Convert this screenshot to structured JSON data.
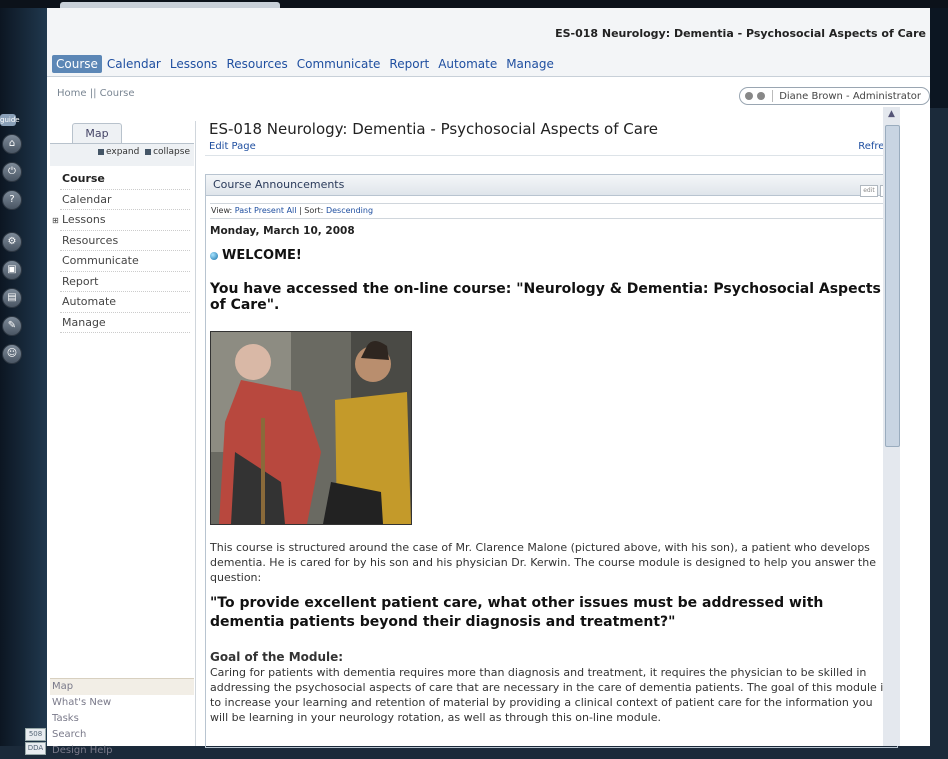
{
  "course_title": "ES-018 Neurology: Dementia - Psychosocial Aspects of Care",
  "nav": {
    "items": [
      "Course",
      "Calendar",
      "Lessons",
      "Resources",
      "Communicate",
      "Report",
      "Automate",
      "Manage"
    ],
    "active": "Course"
  },
  "breadcrumb": "Home || Course",
  "user": "Diane Brown - Administrator",
  "guide_label": "guide",
  "sidebar": {
    "map_tab": "Map",
    "expand": "expand",
    "collapse": "collapse",
    "items": [
      "Course",
      "Calendar",
      "Lessons",
      "Resources",
      "Communicate",
      "Report",
      "Automate",
      "Manage"
    ],
    "footer": [
      "Map",
      "What's New",
      "Tasks",
      "Search",
      "Design Help"
    ],
    "badges": [
      "508",
      "DDA"
    ]
  },
  "page": {
    "title": "ES-018 Neurology: Dementia - Psychosocial Aspects of Care",
    "edit_page": "Edit Page",
    "refresh": "Refresh"
  },
  "announcements": {
    "header": "Course Announcements",
    "header_btn_edit": "edit",
    "header_btn_min": "–",
    "view_label": "View:",
    "view_past": "Past",
    "view_present": "Present",
    "view_all": "All",
    "sort_label": "| Sort:",
    "sort_value": "Descending",
    "date": "Monday, March 10, 2008",
    "welcome": "WELCOME!",
    "accessed": "You have accessed the on-line course: \"Neurology & Dementia: Psychosocial Aspects of Care\".",
    "body": "This course is structured around the case of Mr. Clarence Malone (pictured above, with his son), a patient who develops dementia. He is cared for by his son and his physician Dr. Kerwin.  The course module is designed to help you answer the question:",
    "question": "\"To provide excellent patient care, what other issues must be addressed with dementia patients beyond their diagnosis and treatment?\"",
    "goal_heading": "Goal of the Module:",
    "goal_text": "Caring for patients with dementia requires more than diagnosis and treatment, it requires the physician to be skilled in addressing the psychosocial aspects of care that are necessary in the care of dementia patients. The goal of this module is to increase your learning and retention of material by providing a clinical context of patient care for the information you will be learning in your neurology rotation, as well as through this on-line module."
  }
}
